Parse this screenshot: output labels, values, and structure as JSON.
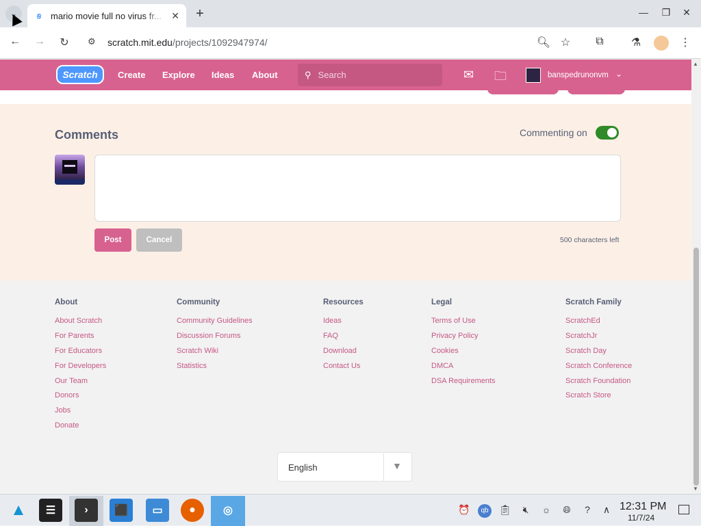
{
  "browser": {
    "tab_title": "mario movie full no virus fr...",
    "url_host": "scratch.mit.edu",
    "url_path": "/projects/1092947974/"
  },
  "scratch_nav": {
    "logo": "Scratch",
    "links": [
      "Create",
      "Explore",
      "Ideas",
      "About"
    ],
    "search_placeholder": "Search",
    "username": "banspedrunonvm"
  },
  "comments": {
    "title": "Comments",
    "commenting_label": "Commenting on",
    "commenting_enabled": true,
    "post_label": "Post",
    "cancel_label": "Cancel",
    "chars_left": "500 characters left"
  },
  "footer": {
    "columns": [
      {
        "heading": "About",
        "links": [
          "About Scratch",
          "For Parents",
          "For Educators",
          "For Developers",
          "Our Team",
          "Donors",
          "Jobs",
          "Donate"
        ]
      },
      {
        "heading": "Community",
        "links": [
          "Community Guidelines",
          "Discussion Forums",
          "Scratch Wiki",
          "Statistics"
        ]
      },
      {
        "heading": "Resources",
        "links": [
          "Ideas",
          "FAQ",
          "Download",
          "Contact Us"
        ]
      },
      {
        "heading": "Legal",
        "links": [
          "Terms of Use",
          "Privacy Policy",
          "Cookies",
          "DMCA",
          "DSA Requirements"
        ]
      },
      {
        "heading": "Scratch Family",
        "links": [
          "ScratchEd",
          "ScratchJr",
          "Scratch Day",
          "Scratch Conference",
          "Scratch Foundation",
          "Scratch Store"
        ]
      }
    ],
    "language": "English"
  },
  "taskbar": {
    "time": "12:31 PM",
    "date": "11/7/24"
  },
  "colors": {
    "scratch_pink": "#d8628f",
    "link_pink": "#c55783",
    "toggle_green": "#2f8a28",
    "comments_bg": "#fcf0e6"
  }
}
